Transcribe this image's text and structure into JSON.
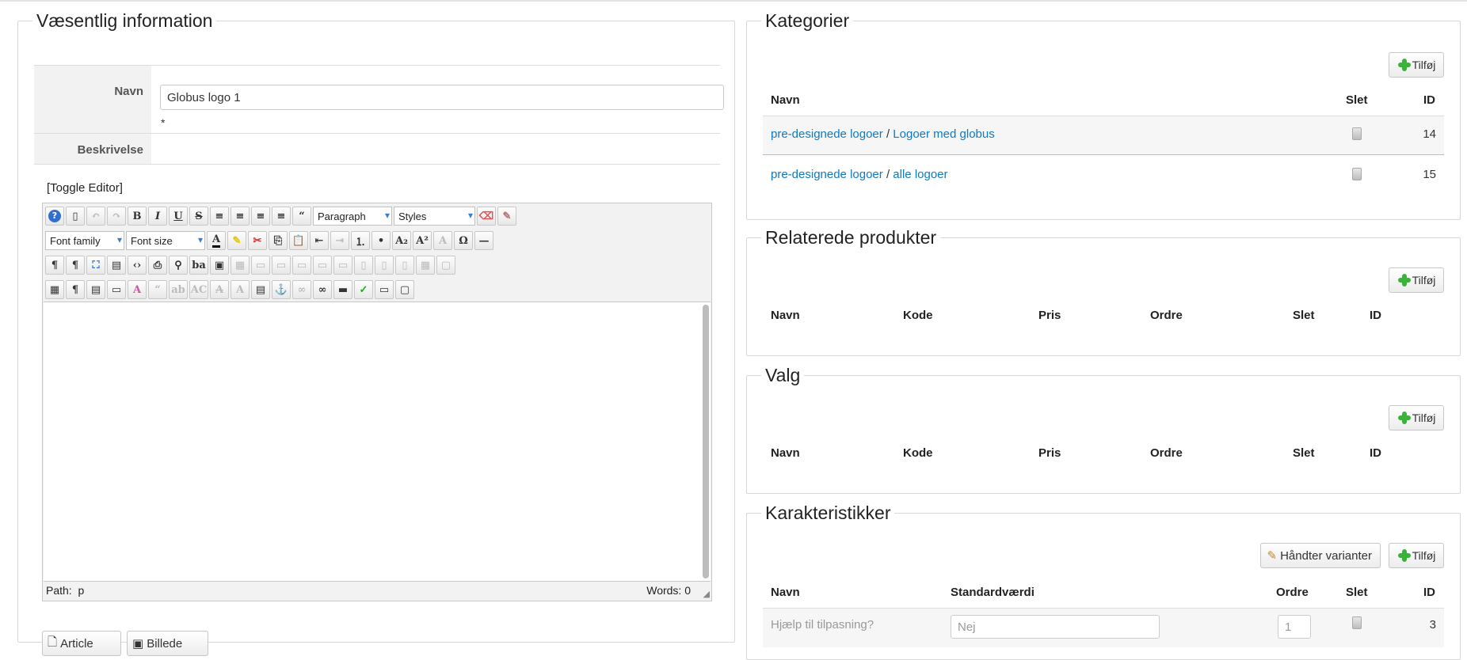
{
  "left": {
    "legend": "Væsentlig information",
    "navn_label": "Navn",
    "navn_value": "Globus logo 1",
    "required_mark": "*",
    "beskrivelse_label": "Beskrivelse",
    "toggle_editor": "[Toggle Editor]",
    "editor": {
      "format_select": "Paragraph",
      "styles_select": "Styles",
      "font_family_select": "Font family",
      "font_size_select": "Font size",
      "status_path_label": "Path:",
      "status_path_value": "p",
      "status_words": "Words: 0"
    },
    "buttons": {
      "article": "Article",
      "billede": "Billede"
    }
  },
  "kategorier": {
    "legend": "Kategorier",
    "add_label": "Tilføj",
    "headers": {
      "navn": "Navn",
      "slet": "Slet",
      "id": "ID"
    },
    "rows": [
      {
        "parent": "pre-designede logoer",
        "sep": "/",
        "name": "Logoer med globus",
        "id": "14"
      },
      {
        "parent": "pre-designede logoer",
        "sep": "/",
        "name": "alle logoer",
        "id": "15"
      }
    ]
  },
  "relaterede": {
    "legend": "Relaterede produkter",
    "add_label": "Tilføj",
    "headers": {
      "navn": "Navn",
      "kode": "Kode",
      "pris": "Pris",
      "ordre": "Ordre",
      "slet": "Slet",
      "id": "ID"
    }
  },
  "valg": {
    "legend": "Valg",
    "add_label": "Tilføj",
    "headers": {
      "navn": "Navn",
      "kode": "Kode",
      "pris": "Pris",
      "ordre": "Ordre",
      "slet": "Slet",
      "id": "ID"
    }
  },
  "karakteristikker": {
    "legend": "Karakteristikker",
    "manage_label": "Håndter varianter",
    "add_label": "Tilføj",
    "headers": {
      "navn": "Navn",
      "standard": "Standardværdi",
      "ordre": "Ordre",
      "slet": "Slet",
      "id": "ID"
    },
    "row": {
      "name": "Hjælp til tilpasning?",
      "value": "Nej",
      "order": "1",
      "id": "3"
    }
  },
  "colors": {
    "link": "#0d7ac4",
    "accent_green": "#3bb33b"
  }
}
